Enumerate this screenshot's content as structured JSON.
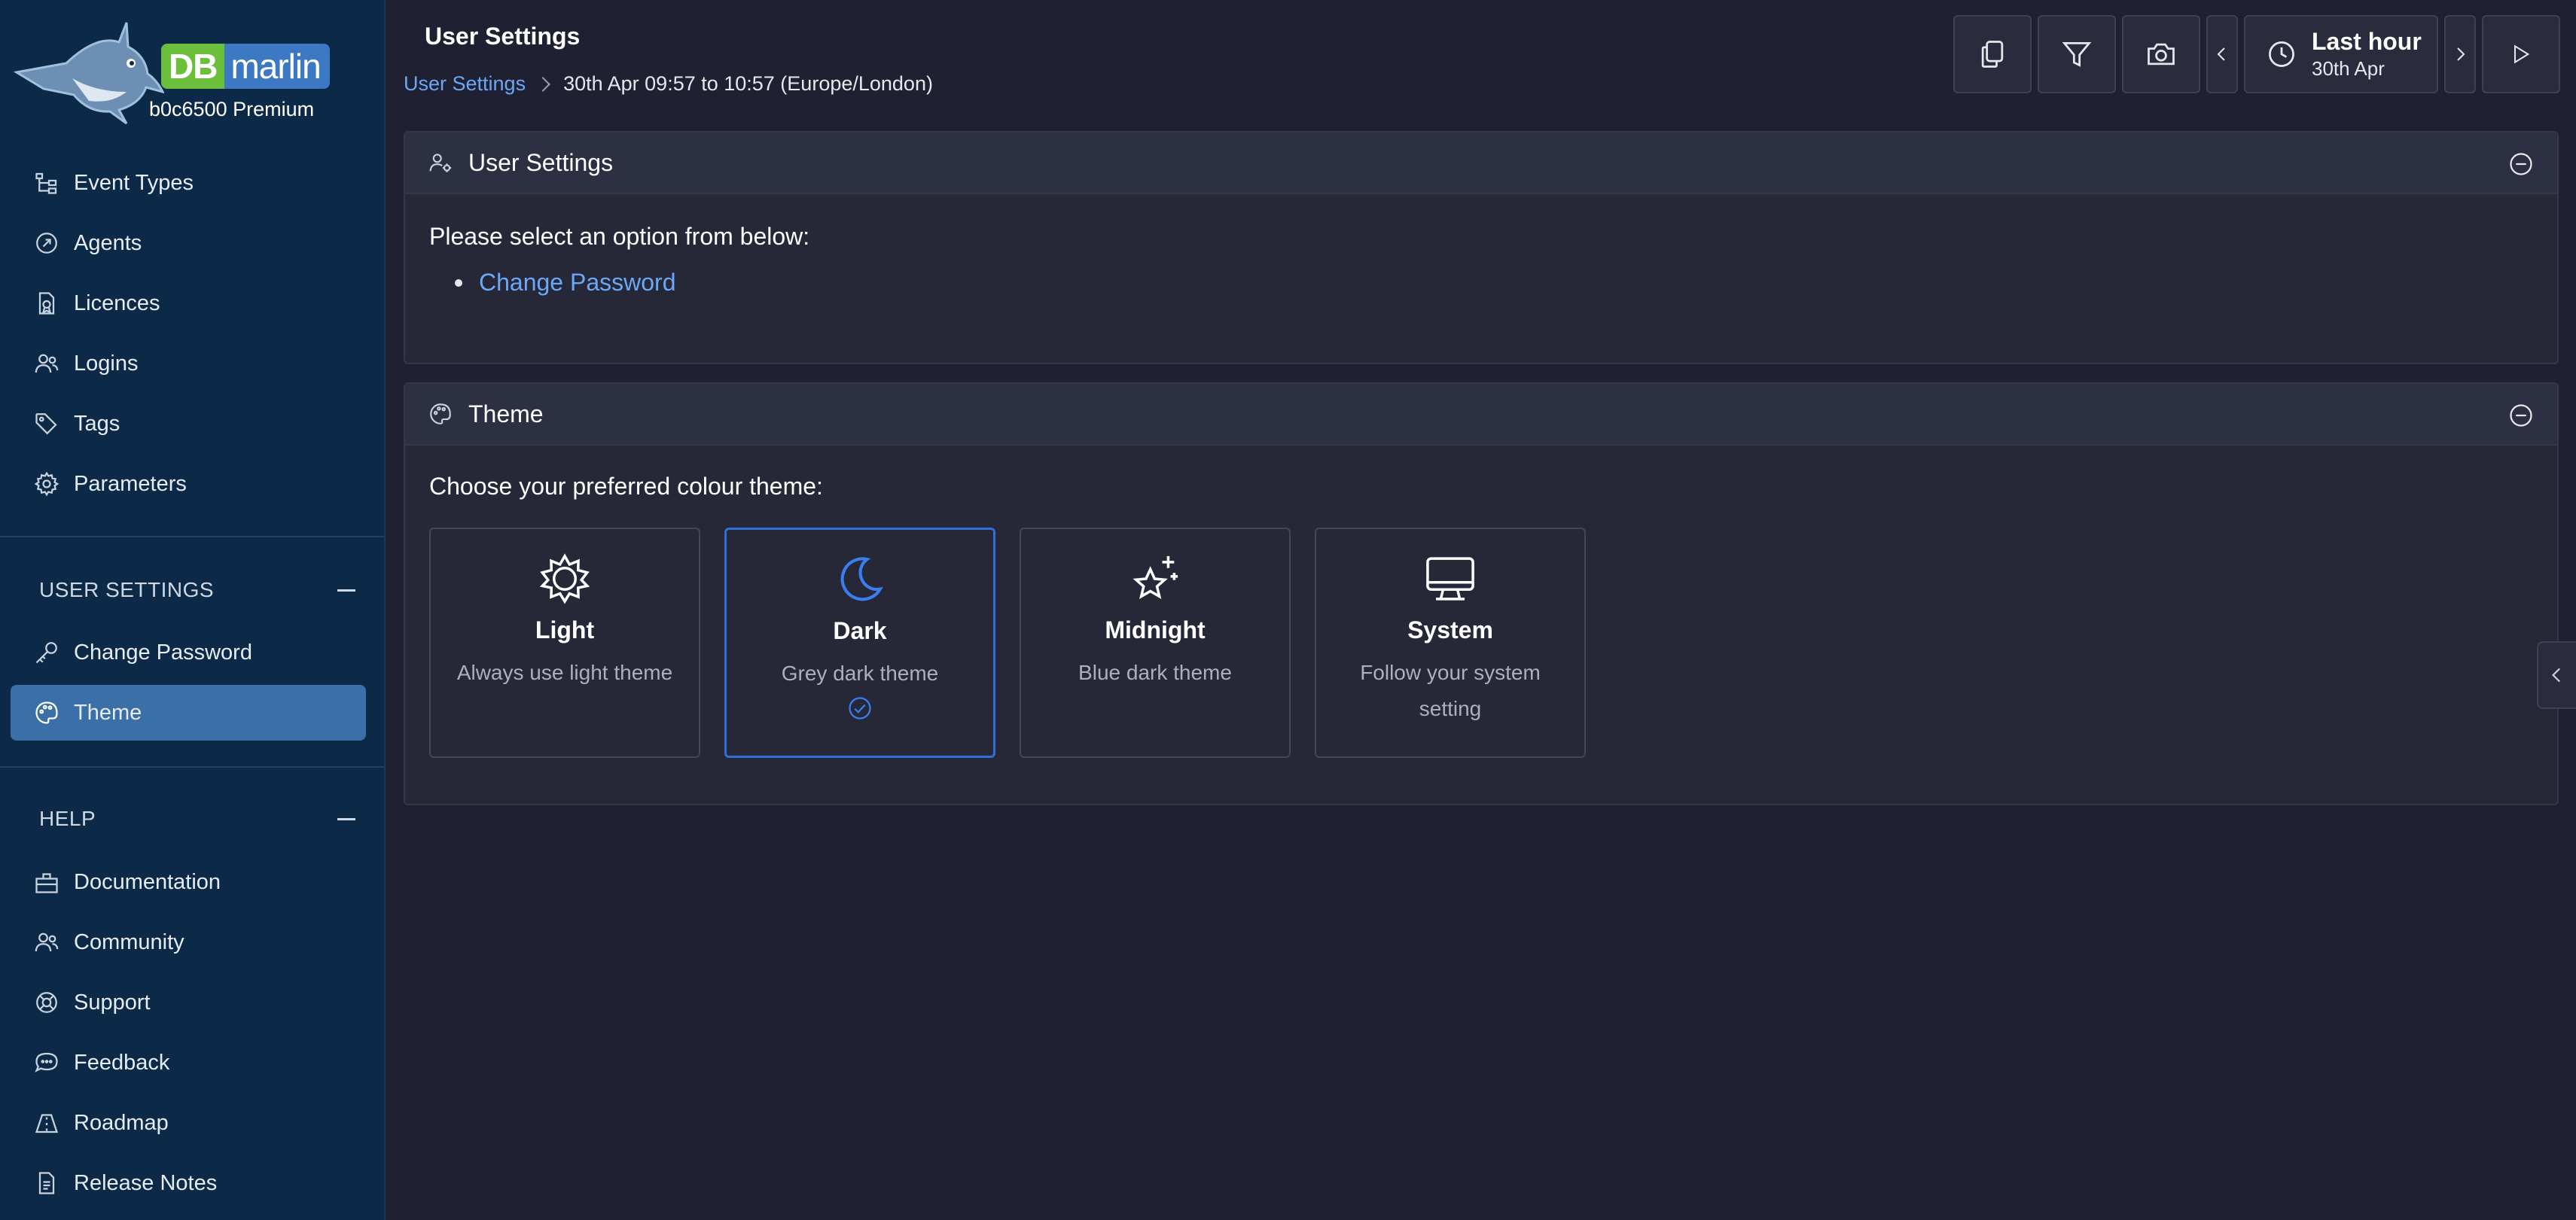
{
  "brand": {
    "logo_db": "DB",
    "logo_marlin": "marlin",
    "org_name": "b0c6500 Premium"
  },
  "sidebar": {
    "main_items": [
      {
        "label": "Event Types",
        "icon": "event-types-icon"
      },
      {
        "label": "Agents",
        "icon": "agents-icon"
      },
      {
        "label": "Licences",
        "icon": "licences-icon"
      },
      {
        "label": "Logins",
        "icon": "logins-icon"
      },
      {
        "label": "Tags",
        "icon": "tag-icon"
      },
      {
        "label": "Parameters",
        "icon": "gear-icon"
      }
    ],
    "user_settings_section": {
      "title": "USER SETTINGS",
      "items": [
        {
          "label": "Change Password",
          "icon": "key-icon"
        },
        {
          "label": "Theme",
          "icon": "palette-icon",
          "active": true
        }
      ]
    },
    "help_section": {
      "title": "HELP",
      "items": [
        {
          "label": "Documentation",
          "icon": "documentation-icon"
        },
        {
          "label": "Community",
          "icon": "community-icon"
        },
        {
          "label": "Support",
          "icon": "support-icon"
        },
        {
          "label": "Feedback",
          "icon": "feedback-icon"
        },
        {
          "label": "Roadmap",
          "icon": "roadmap-icon"
        },
        {
          "label": "Release Notes",
          "icon": "release-notes-icon"
        }
      ]
    }
  },
  "header": {
    "title": "User Settings",
    "breadcrumb_link": "User Settings",
    "time_range": "30th Apr 09:57 to 10:57 (Europe/London)"
  },
  "toolbar": {
    "time_label": "Last hour",
    "time_date": "30th Apr"
  },
  "user_settings_panel": {
    "title": "User Settings",
    "prompt": "Please select an option from below:",
    "link": "Change Password"
  },
  "theme_panel": {
    "title": "Theme",
    "prompt": "Choose your preferred colour theme:",
    "options": [
      {
        "name": "Light",
        "description": "Always use light theme",
        "icon": "sun-icon"
      },
      {
        "name": "Dark",
        "description": "Grey dark theme",
        "icon": "moon-icon",
        "selected": true
      },
      {
        "name": "Midnight",
        "description": "Blue dark theme",
        "icon": "stars-icon"
      },
      {
        "name": "System",
        "description": "Follow your system setting",
        "icon": "monitor-icon"
      }
    ]
  },
  "colors": {
    "sidebar_bg": "#0c2a47",
    "main_bg": "#1f2031",
    "active_item": "#3b6fa8",
    "accent": "#2f6fd8",
    "link": "#6aa8f5"
  }
}
